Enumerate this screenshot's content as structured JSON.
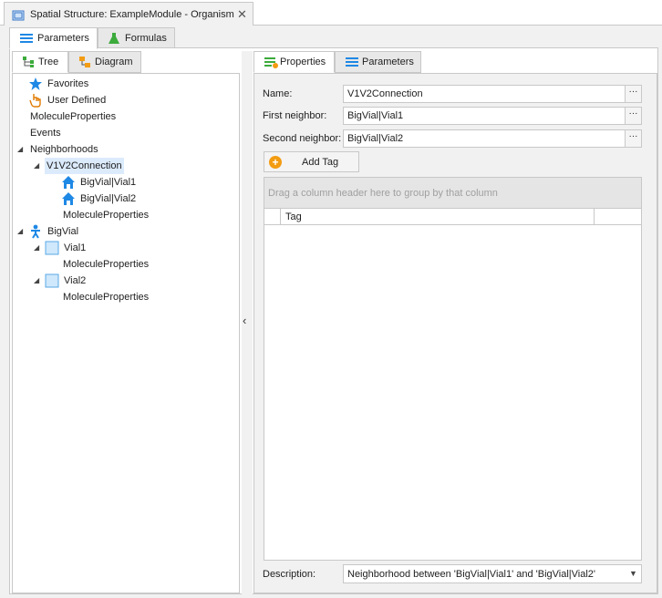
{
  "window": {
    "title": "Spatial Structure: ExampleModule - Organism",
    "close_glyph": "✕"
  },
  "main_tabs": [
    {
      "label": "Parameters",
      "icon": "parameters-icon",
      "active": true
    },
    {
      "label": "Formulas",
      "icon": "formulas-flask-icon",
      "active": false
    }
  ],
  "left_tabs": [
    {
      "label": "Tree",
      "icon": "tree-icon",
      "active": true
    },
    {
      "label": "Diagram",
      "icon": "diagram-icon",
      "active": false
    }
  ],
  "tree": {
    "items": [
      {
        "label": "Favorites",
        "icon": "star-icon",
        "level": 0
      },
      {
        "label": "User Defined",
        "icon": "hand-pointer-icon",
        "level": 0
      },
      {
        "label": "MoleculeProperties",
        "icon": null,
        "level": 0
      },
      {
        "label": "Events",
        "icon": null,
        "level": 0
      },
      {
        "label": "Neighborhoods",
        "icon": null,
        "level": 0,
        "expanded": true
      },
      {
        "label": "V1V2Connection",
        "icon": null,
        "level": 1,
        "expanded": true,
        "selected": true
      },
      {
        "label": "BigVial|Vial1",
        "icon": "house-icon",
        "level": 2
      },
      {
        "label": "BigVial|Vial2",
        "icon": "house-icon",
        "level": 2
      },
      {
        "label": "MoleculeProperties",
        "icon": null,
        "level": 2
      },
      {
        "label": "BigVial",
        "icon": "person-icon",
        "level": 0,
        "expanded": true
      },
      {
        "label": "Vial1",
        "icon": "container-icon",
        "level": 1,
        "expanded": true
      },
      {
        "label": "MoleculeProperties",
        "icon": null,
        "level": 2
      },
      {
        "label": "Vial2",
        "icon": "container-icon",
        "level": 1,
        "expanded": true
      },
      {
        "label": "MoleculeProperties",
        "icon": null,
        "level": 2
      }
    ]
  },
  "splitter": {
    "collapse_glyph": "‹"
  },
  "right_tabs": [
    {
      "label": "Properties",
      "icon": "properties-icon",
      "active": true
    },
    {
      "label": "Parameters",
      "icon": "parameters-icon",
      "active": false
    }
  ],
  "form": {
    "name_label": "Name:",
    "name_value": "V1V2Connection",
    "first_label": "First neighbor:",
    "first_value": "BigVial|Vial1",
    "second_label": "Second neighbor:",
    "second_value": "BigVial|Vial2",
    "ellipsis": "···",
    "add_tag": "Add Tag",
    "add_tag_glyph": "+",
    "group_hint": "Drag a column header here to group by that column",
    "tag_column": "Tag",
    "description_label": "Description:",
    "description_value": "Neighborhood between 'BigVial|Vial1' and 'BigVial|Vial2'",
    "dropdown_glyph": "▼"
  },
  "colors": {
    "accent_blue": "#1e88e5",
    "selection": "#dcebfc",
    "panel_bg": "#f1f1f1",
    "border": "#c8c8c8",
    "add_icon": "#f39c12",
    "formula_green": "#3cab3c"
  }
}
